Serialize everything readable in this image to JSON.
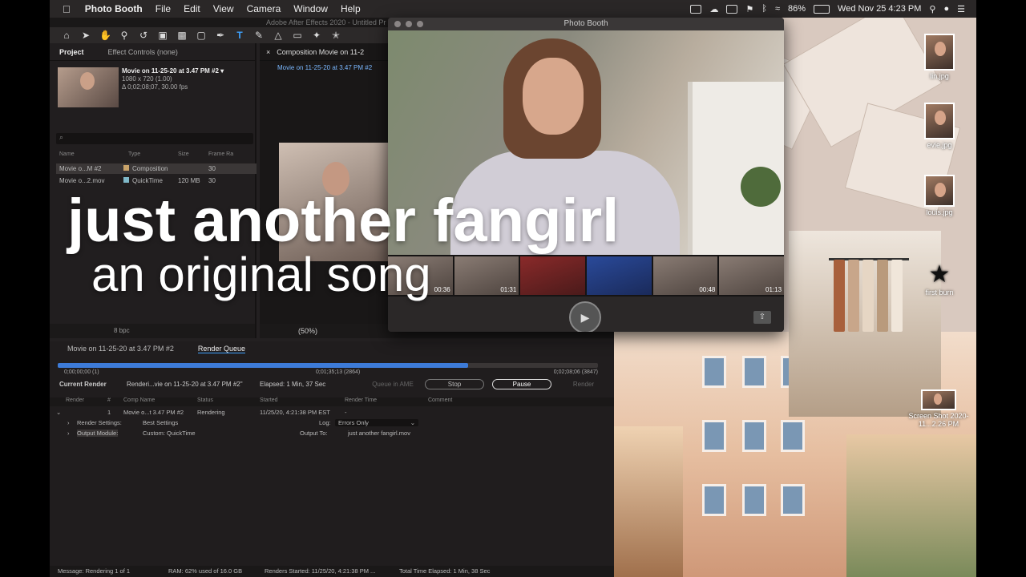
{
  "menubar": {
    "app": "Photo Booth",
    "menus": [
      "File",
      "Edit",
      "View",
      "Camera",
      "Window",
      "Help"
    ],
    "battery": "86%",
    "datetime": "Wed Nov 25  4:23 PM"
  },
  "ae": {
    "window_title": "Adobe After Effects 2020 - Untitled Pr",
    "project_tab": "Project",
    "effect_tab": "Effect Controls (none)",
    "item_name": "Movie on 11-25-20 at 3.47 PM #2 ▾",
    "item_dims": "1080 x 720 (1.00)",
    "item_duration": "Δ 0;02;08;07, 30.00 fps",
    "search_placeholder": "⌕",
    "columns": [
      "Name",
      "Type",
      "Size",
      "Frame Ra"
    ],
    "rows": [
      {
        "name": "Movie o...M #2",
        "type": "Composition",
        "size": "",
        "fps": "30",
        "color": "#c9a36a"
      },
      {
        "name": "Movie o...2.mov",
        "type": "QuickTime",
        "size": "120 MB",
        "fps": "30",
        "color": "#7fb8c8"
      }
    ],
    "bpc": "8 bpc",
    "comp_tab": "Composition Movie on 11-2",
    "comp_sub": "Movie on 11-25-20 at 3.47 PM #2",
    "zoom": "(50%)",
    "rq_tab1": "Movie on 11-25-20 at 3.47 PM #2",
    "rq_tab2": "Render Queue",
    "progress": 0.76,
    "time_start": "0;00;00;00 (1)",
    "time_mid": "0;01;35;13 (2864)",
    "time_end": "0;02;08;06 (3847)",
    "current_render_label": "Current Render",
    "current_render_text": "Renderi...vie on 11-25-20 at 3.47 PM #2\"",
    "elapsed": "Elapsed: 1 Min, 37 Sec",
    "queue_ame": "Queue in AME",
    "stop": "Stop",
    "pause": "Pause",
    "render_btn": "Render",
    "rq_cols": [
      "Render",
      "#",
      "Comp Name",
      "Status",
      "Started",
      "Render Time",
      "Comment"
    ],
    "rq_row": {
      "num": "1",
      "comp": "Movie o...t 3.47 PM #2",
      "status": "Rendering",
      "started": "11/25/20, 4:21:38 PM EST",
      "time": "-"
    },
    "render_settings_label": "Render Settings:",
    "render_settings_value": "Best Settings",
    "log_label": "Log:",
    "log_value": "Errors Only",
    "output_module_label": "Output Module:",
    "output_module_value": "Custom: QuickTime",
    "output_to_label": "Output To:",
    "output_to_value": "just another fangirl.mov",
    "status_message": "Message: Rendering 1 of 1",
    "status_ram": "RAM: 62% used of 16.0 GB",
    "status_started": "Renders Started: 11/25/20, 4:21:38 PM ...",
    "status_total": "Total Time Elapsed: 1 Min, 38 Sec"
  },
  "photobooth": {
    "title": "Photo Booth",
    "thumbs": [
      {
        "label": "00:36"
      },
      {
        "label": "01:31"
      },
      {
        "label": ""
      },
      {
        "label": ""
      },
      {
        "label": "00:48"
      },
      {
        "label": "01:13"
      }
    ]
  },
  "desktop": {
    "icons": [
      {
        "label": "lin.jpg"
      },
      {
        "label": "evie.jpg"
      },
      {
        "label": "louis.jpg"
      },
      {
        "label": "first burn"
      },
      {
        "label": "Screen Shot 2020-11...2.26 PM"
      }
    ]
  },
  "overlay": {
    "title": "just another fangirl",
    "subtitle": "an original song"
  }
}
